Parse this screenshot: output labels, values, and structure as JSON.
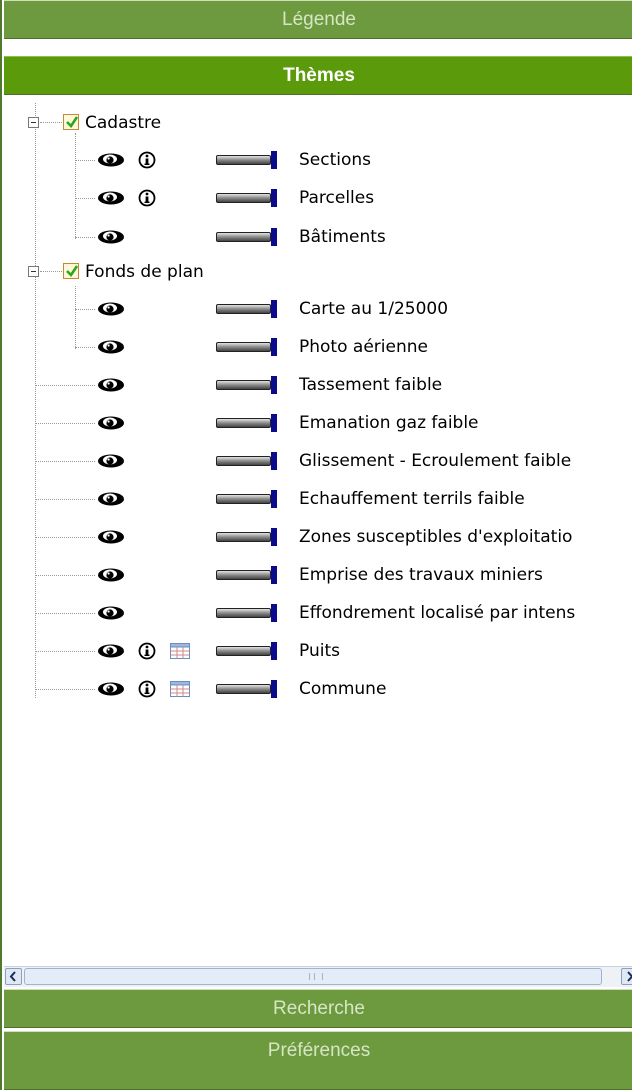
{
  "panel": {
    "legend_label": "Légende",
    "themes_label": "Thèmes",
    "search_label": "Recherche",
    "prefs_label": "Préférences"
  },
  "tree": {
    "groups": [
      {
        "label": "Cadastre",
        "checked": true
      },
      {
        "label": "Fonds de plan",
        "checked": true
      }
    ],
    "layers": [
      {
        "label": "Sections",
        "info": true,
        "table": false
      },
      {
        "label": "Parcelles",
        "info": true,
        "table": false
      },
      {
        "label": "Bâtiments",
        "info": false,
        "table": false
      },
      {
        "label": "Carte au 1/25000",
        "info": false,
        "table": false
      },
      {
        "label": "Photo aérienne",
        "info": false,
        "table": false
      },
      {
        "label": "Tassement faible",
        "info": false,
        "table": false
      },
      {
        "label": "Emanation gaz faible",
        "info": false,
        "table": false
      },
      {
        "label": "Glissement - Ecroulement faible",
        "info": false,
        "table": false
      },
      {
        "label": "Echauffement terrils faible",
        "info": false,
        "table": false
      },
      {
        "label": "Zones susceptibles d'exploitatio",
        "info": false,
        "table": false
      },
      {
        "label": "Emprise des travaux miniers",
        "info": false,
        "table": false
      },
      {
        "label": "Effondrement localisé par intens",
        "info": false,
        "table": false
      },
      {
        "label": "Puits",
        "info": true,
        "table": true
      },
      {
        "label": "Commune",
        "info": true,
        "table": true
      }
    ]
  },
  "colors": {
    "active_header": "#5b9a0a",
    "inactive_header": "#6e9a3f",
    "slider_end": "#0a0a8a"
  }
}
